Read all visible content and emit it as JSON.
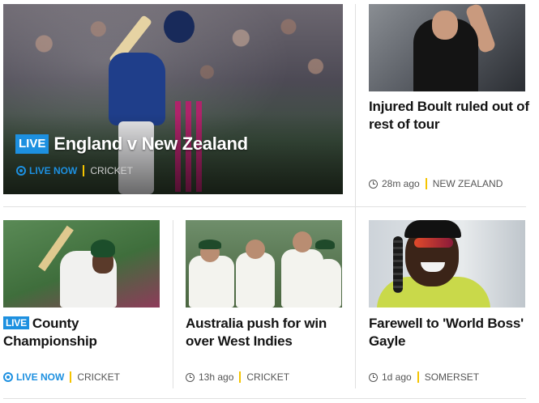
{
  "hero": {
    "live_badge": "LIVE",
    "title": "England v New Zealand",
    "live_label": "LIVE NOW",
    "tag": "CRICKET"
  },
  "cards": {
    "boult": {
      "title": "Injured Boult ruled out of rest of tour",
      "time": "28m ago",
      "tag": "NEW ZEALAND"
    },
    "county": {
      "live_badge": "LIVE",
      "title": "County Championship",
      "live_label": "LIVE NOW",
      "tag": "CRICKET"
    },
    "australia": {
      "title": "Australia push for win over West Indies",
      "time": "13h ago",
      "tag": "CRICKET"
    },
    "gayle": {
      "title": "Farewell to 'World Boss' Gayle",
      "time": "1d ago",
      "tag": "SOMERSET"
    }
  },
  "icons": {
    "live": "live-radio-icon",
    "time": "clock-icon"
  },
  "colors": {
    "accent_blue": "#1d90e0",
    "separator_yellow": "#f5c400",
    "title_text": "#141414",
    "meta_text": "#555555"
  }
}
